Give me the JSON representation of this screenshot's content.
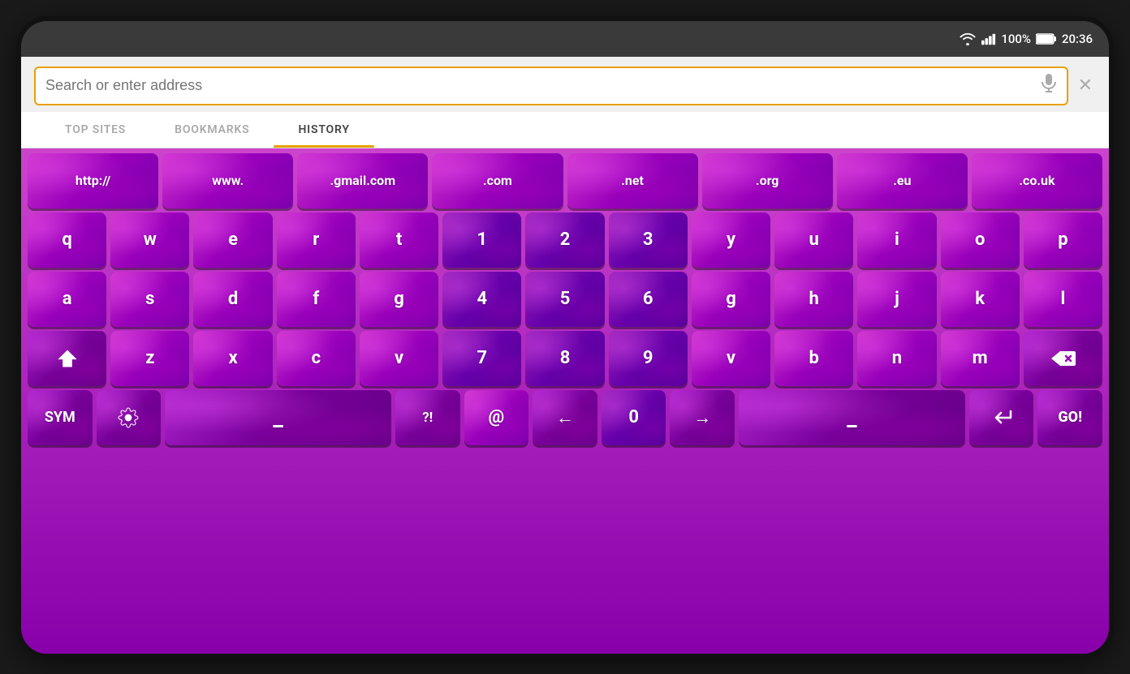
{
  "statusBar": {
    "battery": "100%",
    "time": "20:36",
    "wifi_icon": "wifi",
    "signal_icon": "signal",
    "battery_icon": "battery"
  },
  "searchBar": {
    "placeholder": "Search or enter address",
    "mic_label": "microphone",
    "close_label": "close"
  },
  "tabs": [
    {
      "id": "top-sites",
      "label": "TOP SITES",
      "active": false
    },
    {
      "id": "bookmarks",
      "label": "BOOKMARKS",
      "active": false
    },
    {
      "id": "history",
      "label": "HISTORY",
      "active": true
    }
  ],
  "keyboard": {
    "urlRow": [
      "http://",
      "www.",
      ".gmail.com",
      ".com",
      ".net",
      ".org",
      ".eu",
      ".co.uk"
    ],
    "row1": [
      "q",
      "w",
      "e",
      "r",
      "t",
      "1",
      "2",
      "3",
      "y",
      "u",
      "i",
      "o",
      "p"
    ],
    "row2": [
      "a",
      "s",
      "d",
      "f",
      "g",
      "4",
      "5",
      "6",
      "g",
      "h",
      "j",
      "k",
      "l"
    ],
    "row3_left": [
      "⇧",
      "z",
      "x",
      "c",
      "v"
    ],
    "row3_mid": [
      "7",
      "8",
      "9"
    ],
    "row3_right": [
      "v",
      "b",
      "n",
      "m"
    ],
    "row4": [
      "SYM",
      "⚙",
      "_",
      "?!",
      "@",
      "←",
      "0",
      "→",
      "_",
      "↵",
      "GO!"
    ]
  },
  "colors": {
    "accent": "#e8a000",
    "keyboard_bg_top": "#cc44cc",
    "keyboard_bg_bottom": "#8800aa",
    "key_primary": "#cc33cc",
    "key_num": "#9922bb",
    "active_tab_underline": "#e8a000"
  }
}
